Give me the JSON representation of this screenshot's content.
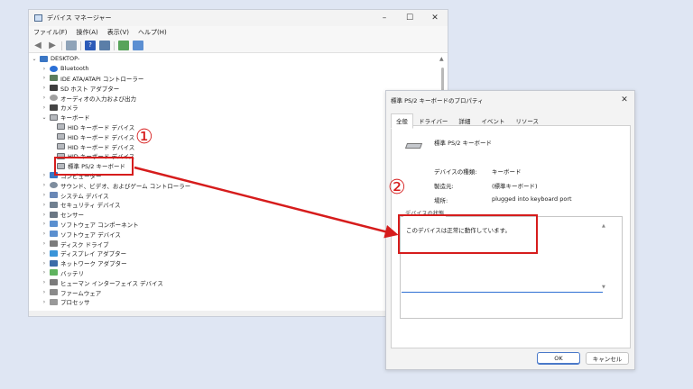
{
  "device_manager": {
    "title": "デバイス マネージャー",
    "window_controls": [
      "–",
      "☐",
      "✕"
    ],
    "menu": [
      "ファイル(F)",
      "操作(A)",
      "表示(V)",
      "ヘルプ(H)"
    ],
    "tree": [
      {
        "label": "DESKTOP-",
        "expander": "⌄",
        "icon": "computer-icon",
        "level": 0
      },
      {
        "label": "Bluetooth",
        "expander": "›",
        "icon": "bluetooth-icon",
        "level": 1
      },
      {
        "label": "IDE ATA/ATAPI コントローラー",
        "expander": "›",
        "icon": "ide-icon",
        "level": 1
      },
      {
        "label": "SD ホスト アダプター",
        "expander": "›",
        "icon": "sd-host-icon",
        "level": 1
      },
      {
        "label": "オーディオの入力および出力",
        "expander": "›",
        "icon": "audio-icon",
        "level": 1
      },
      {
        "label": "カメラ",
        "expander": "›",
        "icon": "camera-icon",
        "level": 1
      },
      {
        "label": "キーボード",
        "expander": "⌄",
        "icon": "keyboard-icon",
        "level": 1
      },
      {
        "label": "HID キーボード デバイス",
        "expander": "",
        "icon": "keyboard-icon",
        "level": 2
      },
      {
        "label": "HID キーボード デバイス",
        "expander": "",
        "icon": "keyboard-icon",
        "level": 2
      },
      {
        "label": "HID キーボード デバイス",
        "expander": "",
        "icon": "keyboard-icon",
        "level": 2
      },
      {
        "label": "HID キーボード デバイス",
        "expander": "",
        "icon": "keyboard-icon",
        "level": 2
      },
      {
        "label": "標準 PS/2 キーボード",
        "expander": "",
        "icon": "keyboard-icon",
        "level": 2
      },
      {
        "label": "コンピューター",
        "expander": "›",
        "icon": "computer-icon",
        "level": 1
      },
      {
        "label": "サウンド、ビデオ、およびゲーム コントローラー",
        "expander": "›",
        "icon": "sound-icon",
        "level": 1
      },
      {
        "label": "システム デバイス",
        "expander": "›",
        "icon": "system-icon",
        "level": 1
      },
      {
        "label": "セキュリティ デバイス",
        "expander": "›",
        "icon": "security-icon",
        "level": 1
      },
      {
        "label": "センサー",
        "expander": "›",
        "icon": "sensor-icon",
        "level": 1
      },
      {
        "label": "ソフトウェア コンポーネント",
        "expander": "›",
        "icon": "software-icon",
        "level": 1
      },
      {
        "label": "ソフトウェア デバイス",
        "expander": "›",
        "icon": "software-device-icon",
        "level": 1
      },
      {
        "label": "ディスク ドライブ",
        "expander": "›",
        "icon": "disk-icon",
        "level": 1
      },
      {
        "label": "ディスプレイ アダプター",
        "expander": "›",
        "icon": "display-icon",
        "level": 1
      },
      {
        "label": "ネットワーク アダプター",
        "expander": "›",
        "icon": "network-icon",
        "level": 1
      },
      {
        "label": "バッテリ",
        "expander": "›",
        "icon": "battery-icon",
        "level": 1
      },
      {
        "label": "ヒューマン インターフェイス デバイス",
        "expander": "›",
        "icon": "hid-icon",
        "level": 1
      },
      {
        "label": "ファームウェア",
        "expander": "›",
        "icon": "firmware-icon",
        "level": 1
      },
      {
        "label": "プロセッサ",
        "expander": "›",
        "icon": "processor-icon",
        "level": 1
      }
    ]
  },
  "properties": {
    "title": "標準 PS/2 キーボードのプロパティ",
    "close": "✕",
    "tabs": [
      "全般",
      "ドライバー",
      "詳細",
      "イベント",
      "リソース"
    ],
    "device_name": "標準 PS/2 キーボード",
    "rows": [
      {
        "label": "デバイスの種類:",
        "value": "キーボード"
      },
      {
        "label": "製造元:",
        "value": "(標準キーボード)"
      },
      {
        "label": "場所:",
        "value": "plugged into keyboard port"
      }
    ],
    "status_label": "デバイスの状態",
    "status_text": "このデバイスは正常に動作しています。",
    "ok": "OK",
    "cancel": "キャンセル"
  },
  "annotations": {
    "step1": "①",
    "step2": "②",
    "color": "#d61c1c"
  }
}
